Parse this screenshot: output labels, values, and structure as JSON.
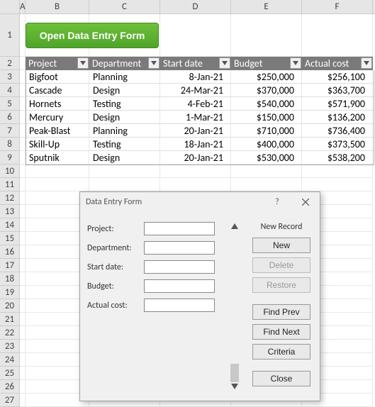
{
  "columns": [
    "A",
    "B",
    "C",
    "D",
    "E",
    "F"
  ],
  "rows": [
    "1",
    "2",
    "3",
    "4",
    "5",
    "6",
    "7",
    "8",
    "9",
    "10",
    "11",
    "12",
    "13",
    "14",
    "15",
    "16",
    "17",
    "18",
    "19",
    "20",
    "21",
    "22",
    "23",
    "24",
    "25",
    "26",
    "27"
  ],
  "green_button_label": "Open Data Entry Form",
  "table": {
    "headers": [
      "Project",
      "Department",
      "Start date",
      "Budget",
      "Actual cost"
    ],
    "rows": [
      {
        "project": "Bigfoot",
        "department": "Planning",
        "start_date": "8-Jan-21",
        "budget": "$250,000",
        "actual_cost": "$256,100"
      },
      {
        "project": "Cascade",
        "department": "Design",
        "start_date": "24-Mar-21",
        "budget": "$370,000",
        "actual_cost": "$363,700"
      },
      {
        "project": "Hornets",
        "department": "Testing",
        "start_date": "4-Feb-21",
        "budget": "$540,000",
        "actual_cost": "$571,900"
      },
      {
        "project": "Mercury",
        "department": "Design",
        "start_date": "1-Mar-21",
        "budget": "$150,000",
        "actual_cost": "$136,200"
      },
      {
        "project": "Peak-Blast",
        "department": "Planning",
        "start_date": "20-Jan-21",
        "budget": "$710,000",
        "actual_cost": "$736,400"
      },
      {
        "project": "Skill-Up",
        "department": "Testing",
        "start_date": "18-Jan-21",
        "budget": "$400,000",
        "actual_cost": "$373,500"
      },
      {
        "project": "Sputnik",
        "department": "Design",
        "start_date": "20-Jan-21",
        "budget": "$530,000",
        "actual_cost": "$538,200"
      }
    ]
  },
  "dialog": {
    "title": "Data Entry Form",
    "record_label": "New Record",
    "fields": {
      "project": "Project:",
      "department": "Department:",
      "start_date": "Start date:",
      "budget": "Budget:",
      "actual_cost": "Actual cost:"
    },
    "buttons": {
      "new": "New",
      "delete": "Delete",
      "restore": "Restore",
      "find_prev": "Find Prev",
      "find_next": "Find Next",
      "criteria": "Criteria",
      "close": "Close"
    }
  }
}
